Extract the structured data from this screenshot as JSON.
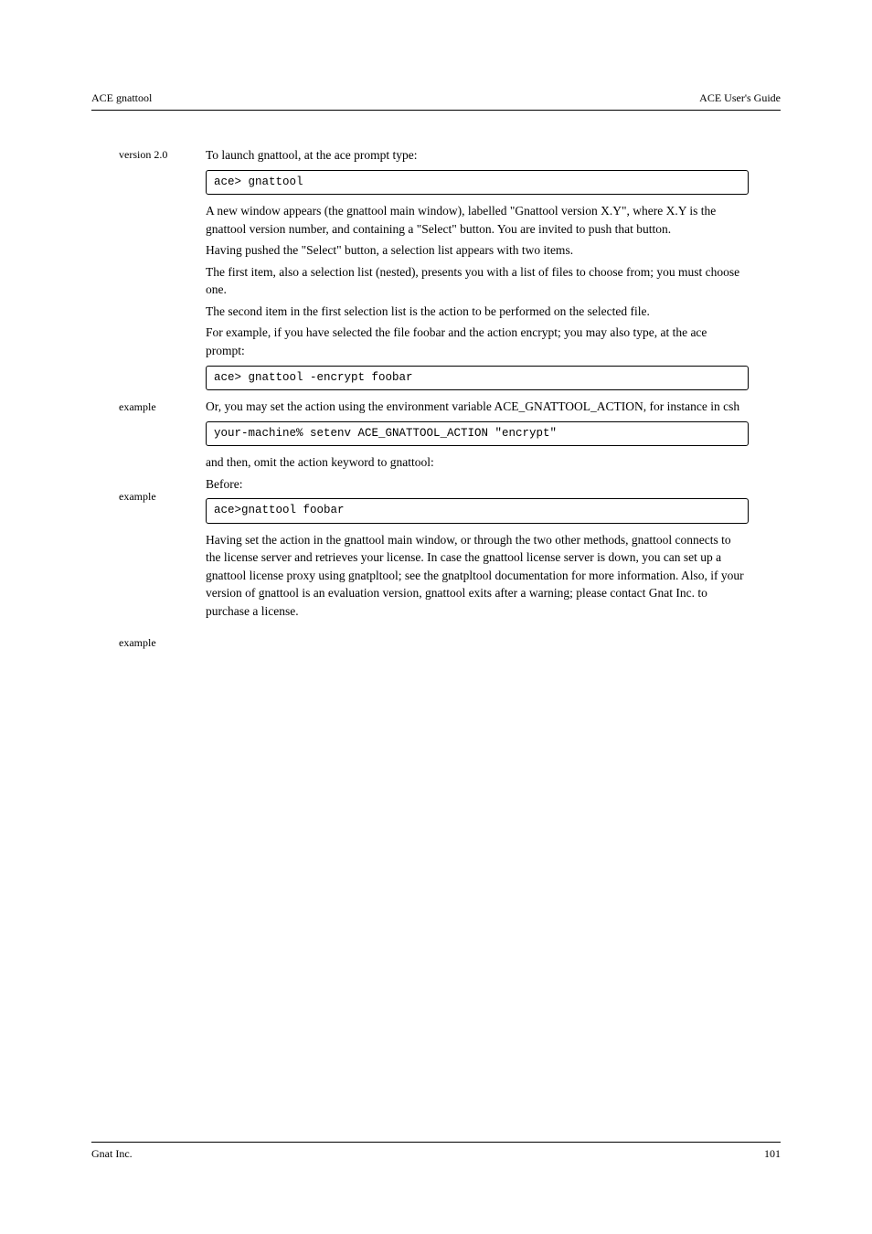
{
  "header": {
    "left": "ACE gnattool",
    "right": "ACE User's Guide"
  },
  "sidebar": {
    "label_version": "version 2.0",
    "label_example1": "example",
    "label_example2": "example",
    "label_example3": "example"
  },
  "content": {
    "p1": "To launch gnattool, at the ace prompt type:",
    "code1": "ace> gnattool",
    "p2": "A new window appears (the gnattool main window), labelled \"Gnattool version X.Y\", where X.Y is the gnattool version number, and containing a \"Select\" button. You are invited to push that button.",
    "p3": "Having pushed the \"Select\" button, a selection list appears with two items.",
    "p4": "The first item, also a selection list (nested), presents you with a list of files to choose from; you must choose one.",
    "p5": "The second item in the first selection list is the action to be performed on the selected file.",
    "p6": "For example, if you have selected the file foobar and the action encrypt; you may also type, at the ace prompt:",
    "code2": "ace> gnattool -encrypt foobar",
    "p7": "Or, you may set the action using the environment variable ACE_GNATTOOL_ACTION, for instance in csh",
    "code3": "your-machine% setenv ACE_GNATTOOL_ACTION \"encrypt\"",
    "p8": "and then, omit the action keyword to gnattool:",
    "p9": "Before:",
    "code4": "ace>gnattool foobar",
    "p10": "Having set the action in the gnattool main window, or through the two other methods, gnattool connects to the license server and retrieves your license. In case the gnattool license server is down, you can set up a gnattool license proxy using gnatpltool; see the gnatpltool documentation for more information. Also, if your version of gnattool is an evaluation version, gnattool exits after a warning; please contact Gnat Inc. to purchase a license."
  },
  "footer": {
    "left": "Gnat Inc.",
    "right": "101"
  }
}
